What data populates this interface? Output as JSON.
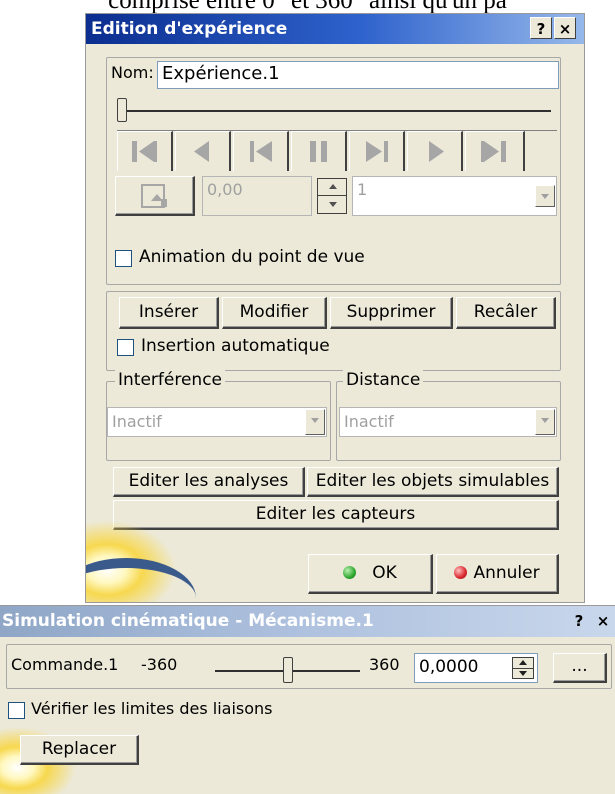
{
  "caption": "comprise entre 0° et 360° ainsi qu'un pa",
  "experience_dialog": {
    "title": "Edition d'expérience",
    "help": "?",
    "close": "×",
    "name_label": "Nom:",
    "name_value": "Expérience.1",
    "time_value": "0,00",
    "step_value": "1",
    "viewpoint_label": "Animation du point de vue",
    "buttons": {
      "insert": "Insérer",
      "modify": "Modifier",
      "delete": "Supprimer",
      "recal": "Recâler"
    },
    "auto_insert_label": "Insertion automatique",
    "interference": {
      "legend": "Interférence",
      "value": "Inactif"
    },
    "distance": {
      "legend": "Distance",
      "value": "Inactif"
    },
    "edit_analyses": "Editer les analyses",
    "edit_simulables": "Editer les objets simulables",
    "edit_sensors": "Editer les capteurs",
    "ok": "OK",
    "cancel": "Annuler"
  },
  "simulation_dialog": {
    "title": "Simulation cinématique - Mécanisme.1",
    "help": "?",
    "close": "×",
    "command_label": "Commande.1",
    "min": "-360",
    "max": "360",
    "slider_fraction": 0.5,
    "value": "0,0000",
    "more": "...",
    "check_limits_label": "Vérifier les limites des liaisons",
    "reset": "Replacer"
  },
  "colors": {
    "ok_icon": "#2ea82e",
    "cancel_icon": "#d9262d"
  }
}
